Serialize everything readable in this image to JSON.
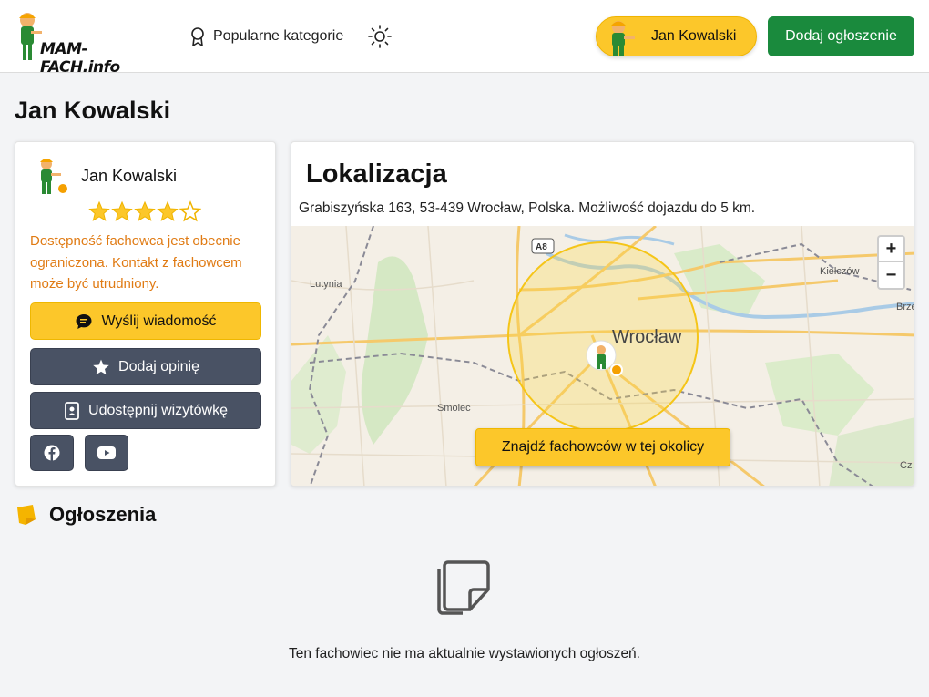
{
  "header": {
    "logo_text": "MAM-FACH.info",
    "nav_categories": "Popularne kategorie",
    "user_name": "Jan Kowalski",
    "add_listing": "Dodaj ogłoszenie"
  },
  "page": {
    "title": "Jan Kowalski"
  },
  "profile": {
    "name": "Jan Kowalski",
    "rating": 4,
    "rating_max": 5,
    "notice": "Dostępność fachowca jest obecnie ograniczona. Kontakt z fachowcem może być utrudniony.",
    "send_message": "Wyślij wiadomość",
    "add_review": "Dodaj opinię",
    "share_card": "Udostępnij wizytówkę",
    "accent_color": "#fcc72a",
    "notice_color": "#e07b14"
  },
  "location": {
    "title": "Lokalizacja",
    "address": "Grabiszyńska 163, 53-439 Wrocław, Polska. Możliwość dojazdu do 5 km.",
    "map_labels": {
      "city": "Wrocław",
      "road": "A8",
      "lutynia": "Lutynia",
      "smolec": "Smolec",
      "kielczow": "Kiełczów",
      "brz": "Brze",
      "cz": "Cz"
    },
    "zoom_in": "+",
    "zoom_out": "−",
    "find_button": "Znajdź fachowców w tej okolicy"
  },
  "ads": {
    "title": "Ogłoszenia",
    "empty_text": "Ten fachowiec nie ma aktualnie wystawionych ogłoszeń."
  }
}
